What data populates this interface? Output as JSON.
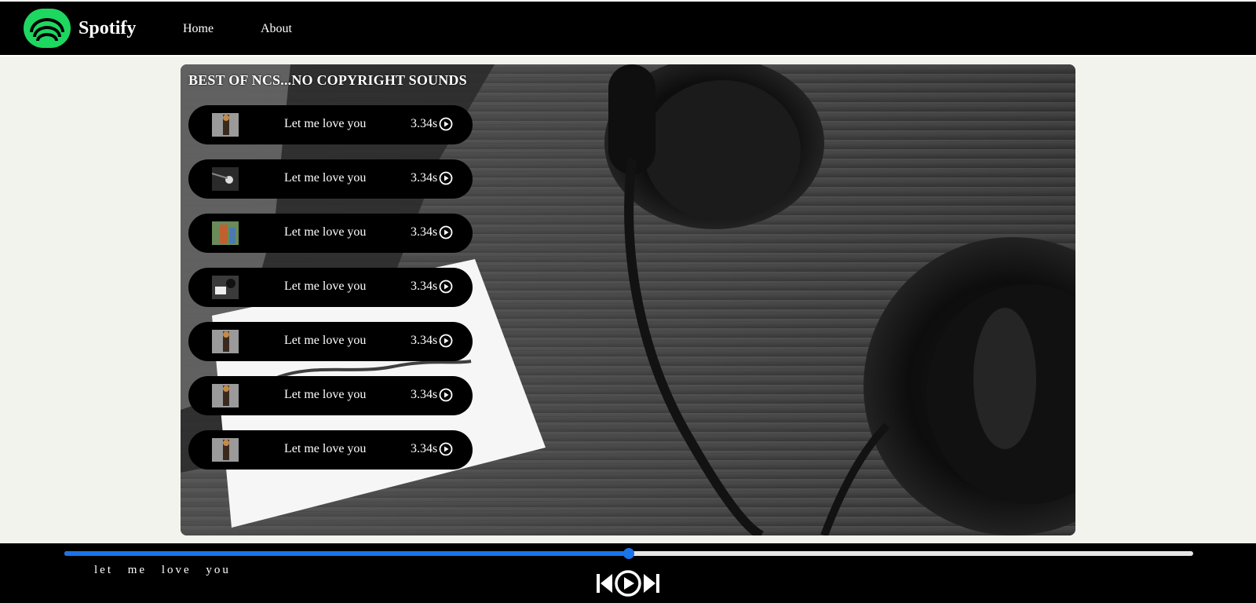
{
  "brand": {
    "name": "Spotify",
    "logo_icon": "spotify-logo-icon",
    "logo_color": "#1ed760"
  },
  "nav": {
    "items": [
      {
        "label": "Home"
      },
      {
        "label": "About"
      }
    ]
  },
  "playlist": {
    "heading": "BEST OF NCS...NO COPYRIGHT SOUNDS",
    "songs": [
      {
        "title": "Let me love you",
        "duration": "3.34s",
        "icon": "play-circle-icon"
      },
      {
        "title": "Let me love you",
        "duration": "3.34s",
        "icon": "play-circle-icon"
      },
      {
        "title": "Let me love you",
        "duration": "3.34s",
        "icon": "play-circle-icon"
      },
      {
        "title": "Let me love you",
        "duration": "3.34s",
        "icon": "play-circle-icon"
      },
      {
        "title": "Let me love you",
        "duration": "3.34s",
        "icon": "play-circle-icon"
      },
      {
        "title": "Let me love you",
        "duration": "3.34s",
        "icon": "play-circle-icon"
      },
      {
        "title": "Let me love you",
        "duration": "3.34s",
        "icon": "play-circle-icon"
      }
    ]
  },
  "player": {
    "now_playing": "let me love you",
    "progress_fraction": 0.5,
    "progress_color": "#1a73e8",
    "controls": [
      "previous-icon",
      "play-circle-icon",
      "next-icon"
    ]
  }
}
